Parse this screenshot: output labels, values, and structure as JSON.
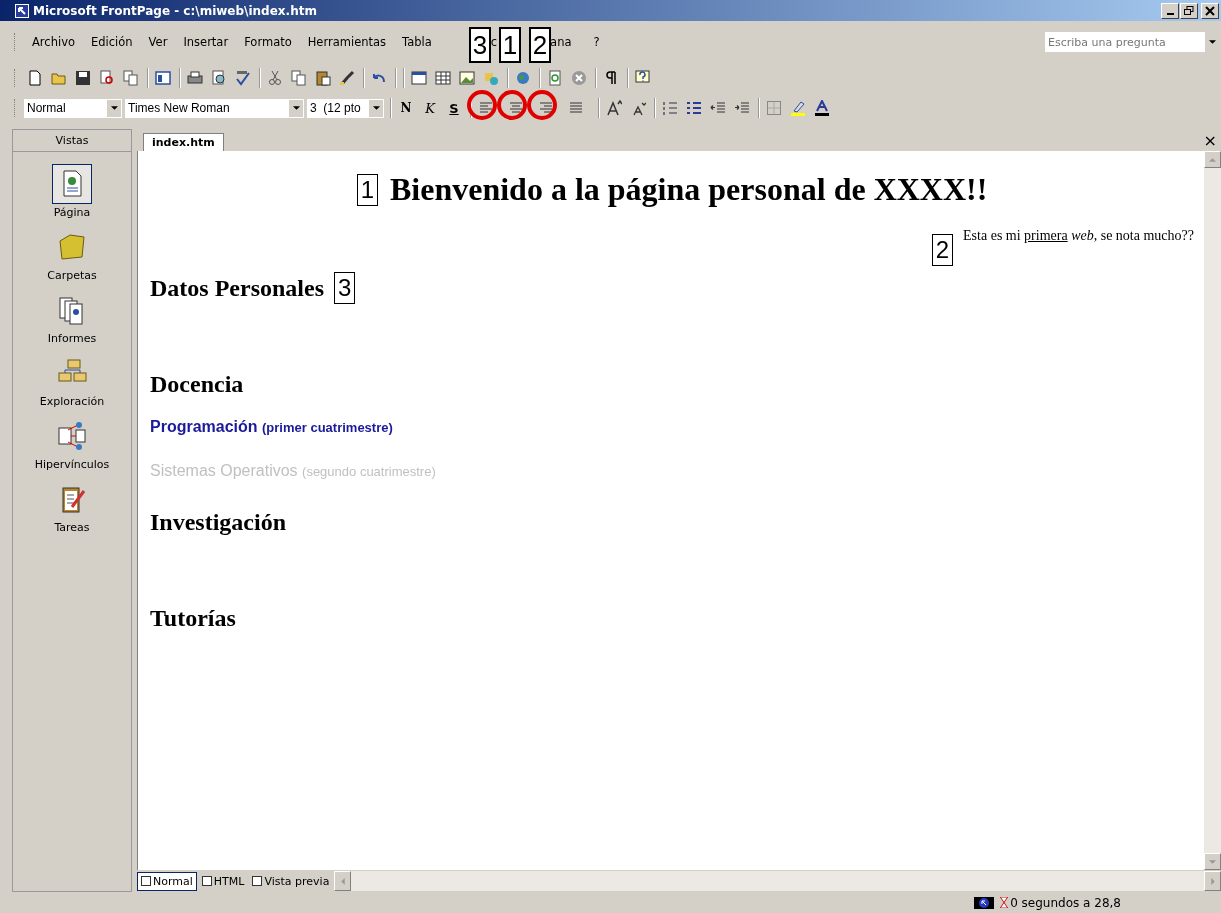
{
  "window": {
    "title": "Microsoft FrontPage - c:\\miweb\\index.htm"
  },
  "menu": [
    "Archivo",
    "Edición",
    "Ver",
    "Insertar",
    "Formato",
    "Herramientas",
    "Tabla",
    "c",
    "ana",
    "?"
  ],
  "help_box": {
    "placeholder": "Escriba una pregunta"
  },
  "format_toolbar": {
    "style": "Normal",
    "font": "Times New Roman",
    "size": "3  (12 pto",
    "bold": "N",
    "italic": "K",
    "underline": "S",
    "align_buttons": [
      {
        "kind": "left",
        "callout": "3"
      },
      {
        "kind": "center",
        "callout": "1"
      },
      {
        "kind": "right",
        "callout": "2"
      },
      {
        "kind": "justify"
      }
    ]
  },
  "views": {
    "header": "Vistas",
    "items": [
      {
        "label": "Página",
        "selected": true
      },
      {
        "label": "Carpetas",
        "selected": false
      },
      {
        "label": "Informes",
        "selected": false
      },
      {
        "label": "Exploración",
        "selected": false
      },
      {
        "label": "Hipervínculos",
        "selected": false
      },
      {
        "label": "Tareas",
        "selected": false
      }
    ]
  },
  "tab": {
    "label": "index.htm",
    "close": "×"
  },
  "document": [
    {
      "kind": "title",
      "text": "Bienvenido a la página personal de XXXX!!",
      "callout": "1"
    },
    {
      "kind": "note",
      "before": "Esta es mi ",
      "underlined": "primera",
      "after": " *web*, se nota mucho??",
      "callout": "2"
    },
    {
      "kind": "heading",
      "text": "Datos Personales",
      "callout": "3"
    },
    {
      "kind": "heading",
      "text": "Docencia"
    },
    {
      "kind": "course",
      "name": "Programación",
      "term": "(primer cuatrimestre)",
      "disabled": false
    },
    {
      "kind": "course",
      "name": "Sistemas Operativos",
      "term": "(segundo cuatrimestre)",
      "disabled": true
    },
    {
      "kind": "heading",
      "text": "Investigación"
    },
    {
      "kind": "heading",
      "text": "Tutorías"
    }
  ],
  "view_tabs": [
    {
      "label": "Normal",
      "selected": true
    },
    {
      "label": "HTML",
      "selected": false
    },
    {
      "label": "Vista previa",
      "selected": false
    }
  ],
  "status_bar": {
    "text": "0 segundos a 28,8"
  }
}
